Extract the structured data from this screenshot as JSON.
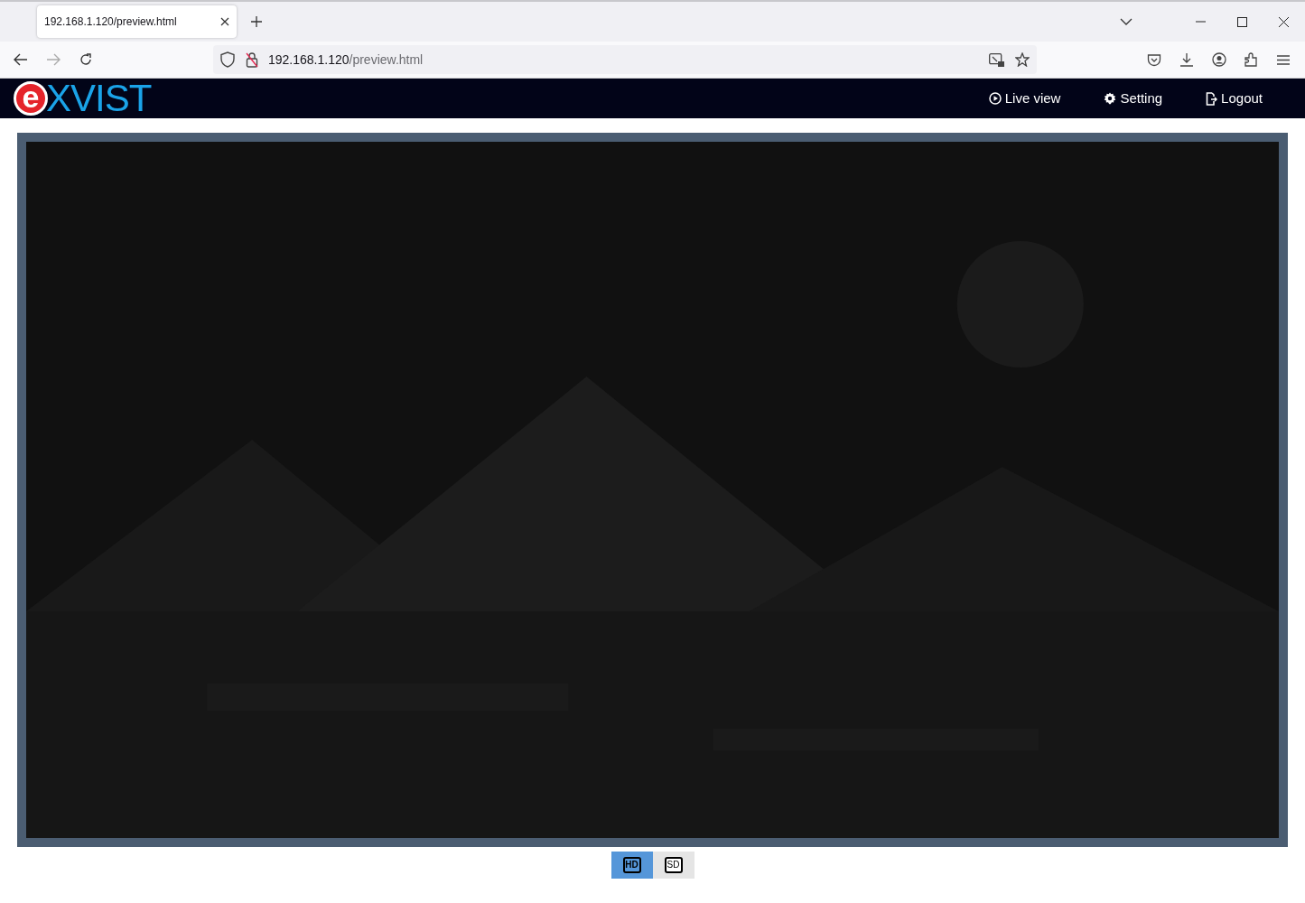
{
  "browser": {
    "tab": {
      "title": "192.168.1.120/preview.html",
      "selected": true
    },
    "address": {
      "host": "192.168.1.120",
      "path": "/preview.html"
    }
  },
  "header": {
    "logo": {
      "mark": "e",
      "rest": "XVIST"
    },
    "nav": [
      {
        "label": "Live view",
        "kind": "live"
      },
      {
        "label": "Setting",
        "kind": "setting"
      },
      {
        "label": "Logout",
        "kind": "logout"
      }
    ]
  },
  "stream_buttons": [
    {
      "label": "HD",
      "selected": true
    },
    {
      "label": "SD",
      "selected": false
    }
  ]
}
